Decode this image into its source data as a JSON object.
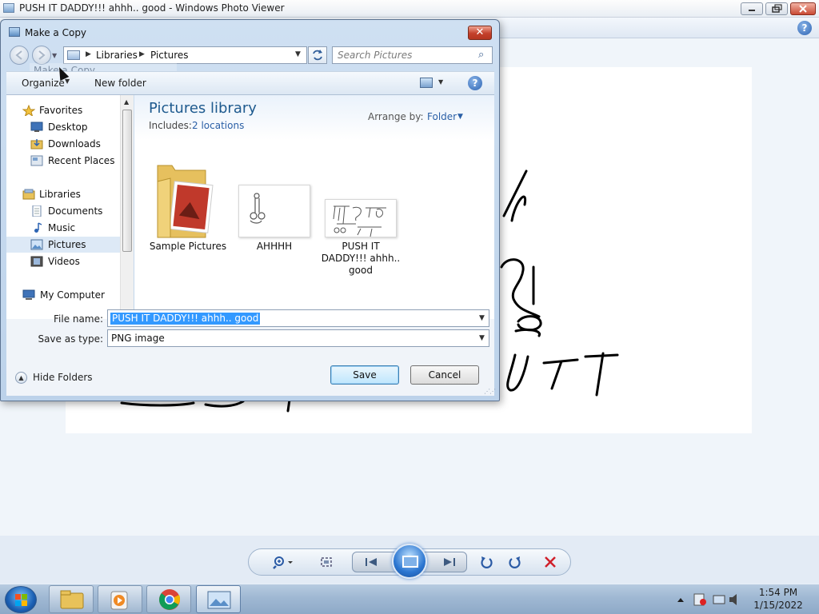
{
  "photo_viewer": {
    "title": "PUSH IT DADDY!!! ahhh.. good - Windows Photo Viewer",
    "help_label": "?",
    "controls": [
      "zoom-icon",
      "actual-size-icon",
      "previous-icon",
      "slideshow-icon",
      "next-icon",
      "rotate-left-icon",
      "rotate-right-icon",
      "delete-icon"
    ]
  },
  "dialog": {
    "title": "Make a Copy",
    "close_label": "✕",
    "tooltip_ghost": "Make a Copy...",
    "address": {
      "crumbs": [
        "Libraries",
        "Pictures"
      ]
    },
    "search": {
      "placeholder": "Search Pictures"
    },
    "toolbar": {
      "organize": "Organize",
      "new_folder": "New folder",
      "help_label": "?"
    },
    "nav": {
      "favorites": "Favorites",
      "favorites_items": [
        "Desktop",
        "Downloads",
        "Recent Places"
      ],
      "libraries": "Libraries",
      "libraries_items": [
        "Documents",
        "Music",
        "Pictures",
        "Videos"
      ],
      "computer": "My Computer",
      "selected": "Pictures"
    },
    "library": {
      "title": "Pictures library",
      "includes_label": "Includes:",
      "locations": "2 locations",
      "arrange_label": "Arrange by:",
      "arrange_value": "Folder"
    },
    "items": [
      {
        "name": "Sample Pictures",
        "type": "folder"
      },
      {
        "name": "AHHHH",
        "type": "image"
      },
      {
        "name": "PUSH IT DADDY!!! ahhh.. good",
        "type": "image"
      }
    ],
    "filename_label": "File name:",
    "filename_value": "PUSH IT DADDY!!! ahhh.. good",
    "filetype_label": "Save as type:",
    "filetype_value": "PNG image",
    "hide_folders": "Hide Folders",
    "save_label": "Save",
    "cancel_label": "Cancel"
  },
  "taskbar": {
    "time": "1:54 PM",
    "date": "1/15/2022"
  }
}
